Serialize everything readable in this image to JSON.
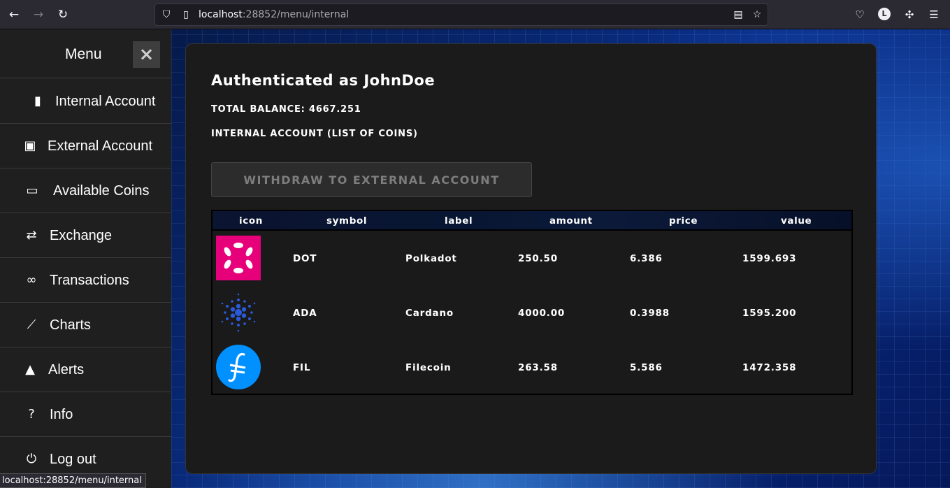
{
  "browser": {
    "url_host": "localhost",
    "url_rest": ":28852/menu/internal",
    "avatar_letter": "L",
    "status_url": "localhost:28852/menu/internal"
  },
  "sidebar": {
    "title": "Menu",
    "close_icon": "×",
    "items": [
      {
        "label": "Internal Account",
        "icon": "address-book-icon"
      },
      {
        "label": "External Account",
        "icon": "contact-card-icon"
      },
      {
        "label": "Available Coins",
        "icon": "money-bill-icon"
      },
      {
        "label": "Exchange",
        "icon": "exchange-arrows-icon"
      },
      {
        "label": "Transactions",
        "icon": "link-icon"
      },
      {
        "label": "Charts",
        "icon": "line-chart-icon"
      },
      {
        "label": "Alerts",
        "icon": "bell-icon"
      },
      {
        "label": "Info",
        "icon": "question-circle-icon"
      },
      {
        "label": "Log out",
        "icon": "power-icon"
      }
    ]
  },
  "main": {
    "auth_title": "Authenticated as JohnDoe",
    "balance": "TOTAL BALANCE: 4667.251",
    "account_label": "INTERNAL ACCOUNT (LIST OF COINS)",
    "withdraw_label": "WITHDRAW TO EXTERNAL ACCOUNT",
    "table": {
      "headers": [
        "icon",
        "symbol",
        "label",
        "amount",
        "price",
        "value"
      ],
      "rows": [
        {
          "symbol": "DOT",
          "label": "Polkadot",
          "amount": "250.50",
          "price": "6.386",
          "value": "1599.693",
          "icon": "polkadot-logo-icon"
        },
        {
          "symbol": "ADA",
          "label": "Cardano",
          "amount": "4000.00",
          "price": "0.3988",
          "value": "1595.200",
          "icon": "cardano-logo-icon"
        },
        {
          "symbol": "FIL",
          "label": "Filecoin",
          "amount": "263.58",
          "price": "5.586",
          "value": "1472.358",
          "icon": "filecoin-logo-icon"
        }
      ]
    }
  },
  "colors": {
    "sidebar_bg": "#1f1f1f",
    "panel_bg": "#1b1b1b",
    "polkadot_pink": "#e6007a",
    "filecoin_blue": "#0090ff",
    "cardano_blue": "#2a5ada"
  }
}
